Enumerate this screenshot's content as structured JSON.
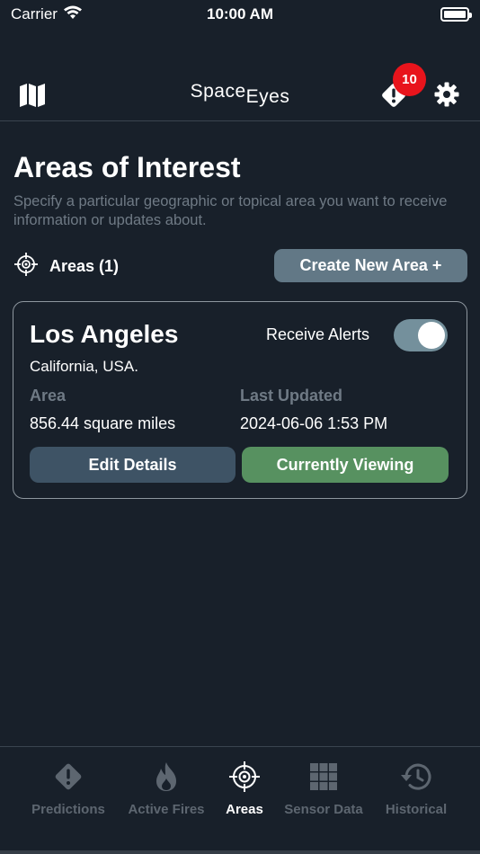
{
  "status_bar": {
    "carrier": "Carrier",
    "time": "10:00 AM",
    "icons": [
      "wifi-icon",
      "battery-icon"
    ]
  },
  "header": {
    "logo_part1": "Space",
    "logo_part2": "Eyes",
    "map_icon": "map-icon",
    "alert_icon": "alert-diamond-icon",
    "alert_badge": "10",
    "settings_icon": "gear-icon",
    "badge_color": "#e8141c"
  },
  "page": {
    "title": "Areas of Interest",
    "description": "Specify a particular geographic or topical area you want to receive information or updates about."
  },
  "areas_section": {
    "icon": "crosshair-icon",
    "label": "Areas (1)",
    "create_button": "Create New Area +"
  },
  "area_card": {
    "name": "Los Angeles",
    "location": "California, USA.",
    "receive_alerts_label": "Receive Alerts",
    "receive_alerts_on": true,
    "area_label": "Area",
    "area_value": "856.44 square miles",
    "last_updated_label": "Last Updated",
    "last_updated_value": "2024-06-06 1:53 PM",
    "edit_button": "Edit Details",
    "viewing_button": "Currently Viewing",
    "colors": {
      "edit": "#3e5365",
      "viewing": "#579160",
      "toggle": "#74909c"
    }
  },
  "tab_bar": {
    "tabs": [
      {
        "label": "Predictions",
        "icon": "warning-diamond-icon",
        "active": false
      },
      {
        "label": "Active Fires",
        "icon": "flame-icon",
        "active": false
      },
      {
        "label": "Areas",
        "icon": "crosshair-icon",
        "active": true
      },
      {
        "label": "Sensor Data",
        "icon": "grid-icon",
        "active": false
      },
      {
        "label": "Historical",
        "icon": "history-icon",
        "active": false
      }
    ]
  },
  "colors": {
    "background": "#18202a",
    "muted_text": "#6f7a85",
    "accent_button": "#627886"
  }
}
